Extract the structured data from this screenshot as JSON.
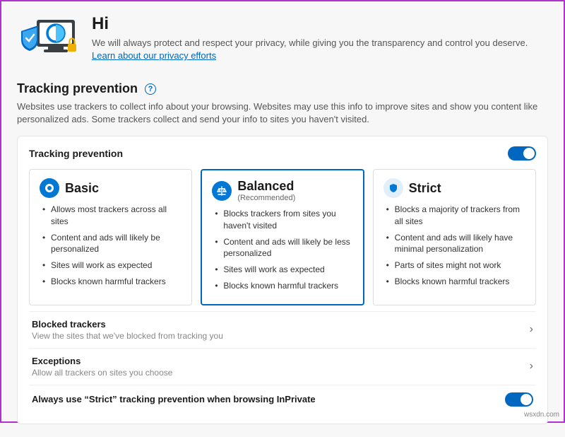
{
  "hero": {
    "greeting": "Hi",
    "body": "We will always protect and respect your privacy, while giving you the transparency and control you deserve. ",
    "linkText": "Learn about our privacy efforts"
  },
  "section": {
    "title": "Tracking prevention",
    "desc": "Websites use trackers to collect info about your browsing. Websites may use this info to improve sites and show you content like personalized ads. Some trackers collect and send your info to sites you haven't visited."
  },
  "card": {
    "title": "Tracking prevention"
  },
  "levels": {
    "basic": {
      "title": "Basic",
      "b1": "Allows most trackers across all sites",
      "b2": "Content and ads will likely be personalized",
      "b3": "Sites will work as expected",
      "b4": "Blocks known harmful trackers"
    },
    "balanced": {
      "title": "Balanced",
      "sub": "(Recommended)",
      "b1": "Blocks trackers from sites you haven't visited",
      "b2": "Content and ads will likely be less personalized",
      "b3": "Sites will work as expected",
      "b4": "Blocks known harmful trackers"
    },
    "strict": {
      "title": "Strict",
      "b1": "Blocks a majority of trackers from all sites",
      "b2": "Content and ads will likely have minimal personalization",
      "b3": "Parts of sites might not work",
      "b4": "Blocks known harmful trackers"
    }
  },
  "rows": {
    "blocked": {
      "title": "Blocked trackers",
      "sub": "View the sites that we've blocked from tracking you"
    },
    "exceptions": {
      "title": "Exceptions",
      "sub": "Allow all trackers on sites you choose"
    },
    "inprivate": {
      "title": "Always use “Strict” tracking prevention when browsing InPrivate"
    }
  },
  "watermark": "wsxdn.com"
}
